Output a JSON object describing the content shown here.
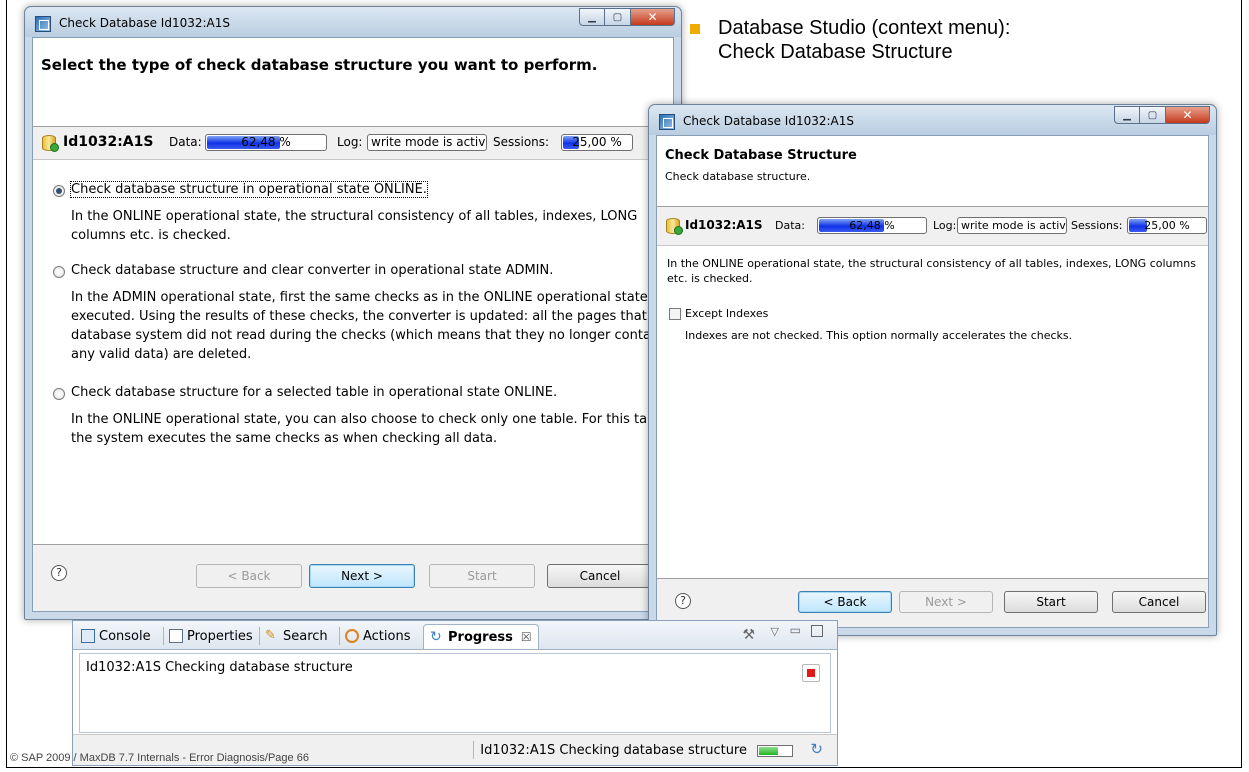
{
  "bullet": {
    "text": "Database Studio (context menu):\nCheck Database Structure"
  },
  "dialog1": {
    "title": "Check Database Id1032:A1S",
    "heading": "Select the type of check database structure you want to perform.",
    "db_name": "Id1032:A1S",
    "data_label": "Data:",
    "data_value": "62,48 %",
    "data_fill": 0.6248,
    "log_label": "Log:",
    "log_value": "write mode is activ",
    "sessions_label": "Sessions:",
    "sessions_value": "25,00 %",
    "sessions_fill": 0.25,
    "options": [
      {
        "label": "Check database structure in operational state ONLINE.",
        "selected": true,
        "description": "In the ONLINE operational state, the structural consistency of all tables, indexes, LONG columns etc. is checked."
      },
      {
        "label": "Check database structure and clear converter in operational state ADMIN.",
        "selected": false,
        "description": "In the ADMIN operational state, first the same checks as in the ONLINE operational state are executed. Using the results of these checks, the converter is updated: all the pages that the database system did not read during the checks (which means that they no longer contain any valid data) are deleted."
      },
      {
        "label": "Check database structure for a selected table in operational state ONLINE.",
        "selected": false,
        "description": "In the ONLINE operational state, you can also choose to check only one table. For this table the system executes the same checks as when checking all data."
      }
    ],
    "buttons": {
      "back": "< Back",
      "next": "Next >",
      "start": "Start",
      "cancel": "Cancel"
    },
    "help": "?"
  },
  "dialog2": {
    "title": "Check Database Id1032:A1S",
    "heading": "Check Database Structure",
    "subheading": "Check database structure.",
    "db_name": "Id1032:A1S",
    "data_label": "Data:",
    "data_value": "62,48 %",
    "data_fill": 0.6248,
    "log_label": "Log:",
    "log_value": "write mode is activ",
    "sessions_label": "Sessions:",
    "sessions_value": "25,00 %",
    "sessions_fill": 0.25,
    "description": "In the ONLINE operational state, the structural consistency of all tables, indexes, LONG columns etc. is checked.",
    "checkbox_label": "Except Indexes",
    "checkbox_checked": false,
    "checkbox_description": "Indexes are not checked. This option normally accelerates the checks.",
    "buttons": {
      "back": "< Back",
      "next": "Next >",
      "start": "Start",
      "cancel": "Cancel"
    },
    "help": "?"
  },
  "progress_view": {
    "tabs": [
      "Console",
      "Properties",
      "Search",
      "Actions",
      "Progress"
    ],
    "active_tab": "Progress",
    "close_glyph": "☒",
    "job": "Id1032:A1S Checking database structure",
    "status_text": "Id1032:A1S Checking database structure"
  },
  "copyright": "© SAP 2009 / MaxDB 7.7 Internals - Error Diagnosis/Page 66",
  "colors": {
    "bullet": "#f0ab00",
    "meter_fill": "#1032e8",
    "stop": "#e01818"
  }
}
